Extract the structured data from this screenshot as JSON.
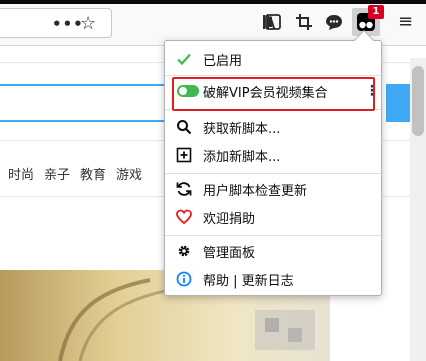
{
  "toolbar": {
    "more_label": "•••",
    "bookmark_glyph": "☆",
    "menu_glyph": "≡",
    "badge_count": "1"
  },
  "page": {
    "nav_tabs": [
      "时尚",
      "亲子",
      "教育",
      "游戏"
    ]
  },
  "panel": {
    "enabled_label": "已启用",
    "script_name": "破解VIP会员视频集合",
    "script_more": "⋮",
    "get_scripts": "获取新脚本...",
    "add_script": "添加新脚本...",
    "check_updates": "用户脚本检查更新",
    "donate": "欢迎捐助",
    "dashboard": "管理面板",
    "help": "帮助 | 更新日志"
  },
  "colors": {
    "accent_green": "#3fb950",
    "highlight_red": "#e02020",
    "badge_red": "#d70022",
    "link_blue": "#3fa9f5",
    "info_blue": "#0a84ff"
  },
  "icons": [
    "check-icon",
    "toggle-icon",
    "search-icon",
    "plus-square-icon",
    "refresh-icon",
    "heart-icon",
    "gear-icon",
    "info-icon",
    "library-icon",
    "sidebar-icon",
    "crop-icon",
    "chat-icon",
    "tampermonkey-icon"
  ]
}
